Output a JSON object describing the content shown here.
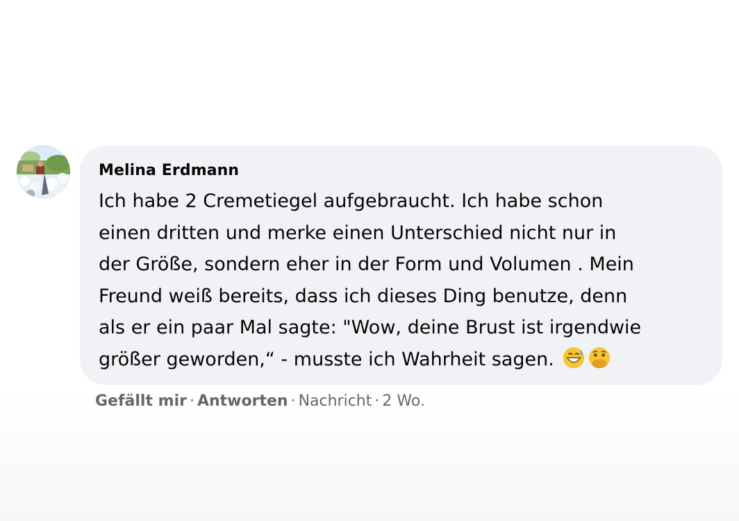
{
  "comment": {
    "author": "Melina Erdmann",
    "lines": [
      "Ich habe 2 Cremetiegel aufgebraucht. Ich habe schon",
      "einen dritten und merke einen Unterschied nicht nur in",
      "der Größe, sondern eher in der Form und Volumen . Mein",
      "Freund weiß bereits, dass ich dieses Ding benutze, denn",
      "als er ein paar Mal sagte: \"Wow, deine Brust ist irgendwie",
      "größer geworden,“ - musste ich Wahrheit sagen."
    ],
    "emojis": [
      "grinning-sweat-emoji",
      "face-with-hand-over-mouth-emoji"
    ],
    "avatar_icon": "profile-photo-avatar"
  },
  "actions": {
    "like": "Gefällt mir",
    "reply": "Antworten",
    "message": "Nachricht",
    "time": "2 Wo.",
    "separator": "·"
  },
  "colors": {
    "bubble": "#f0f2f5",
    "text": "#050505",
    "secondary": "#65676b"
  }
}
